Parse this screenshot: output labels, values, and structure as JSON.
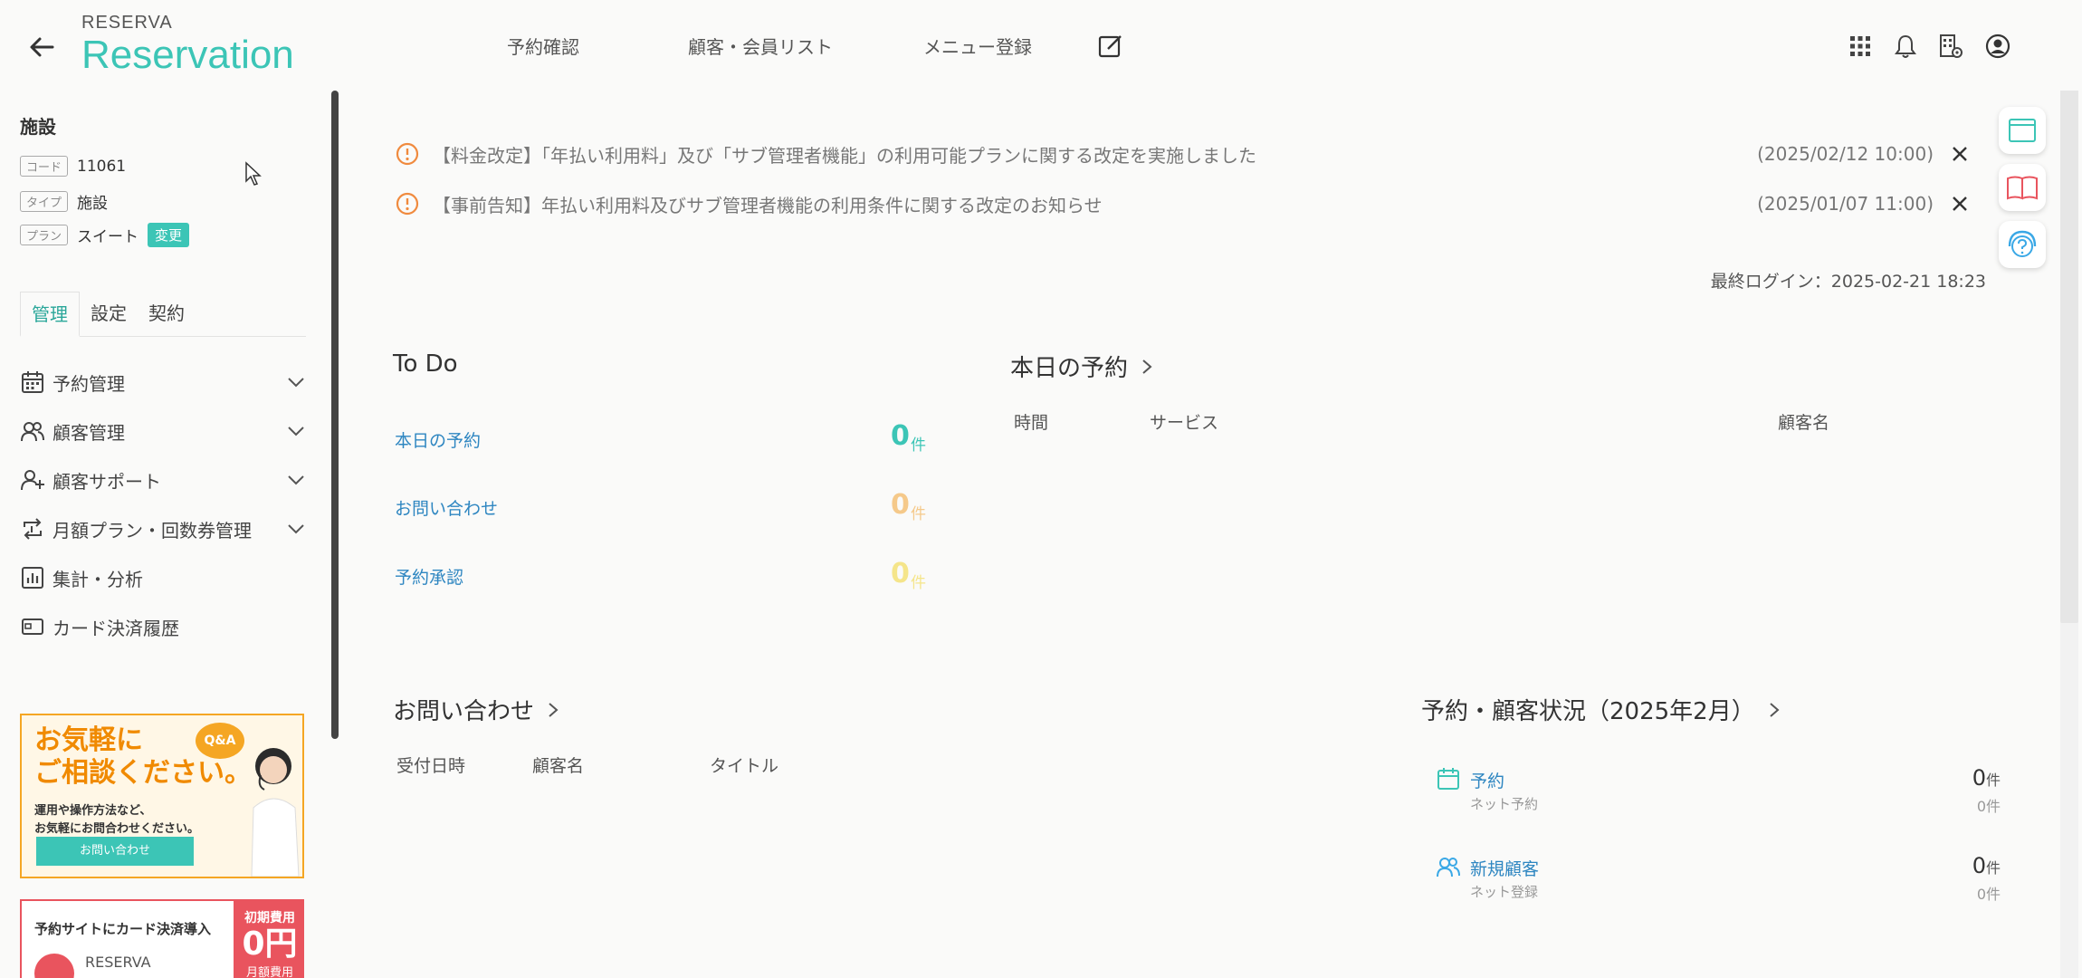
{
  "header": {
    "logo_small": "RESERVA",
    "logo_big": "Reservation",
    "nav": [
      "予約確認",
      "顧客・会員リスト",
      "メニュー登録"
    ]
  },
  "sidebar": {
    "title": "施設",
    "code_tag": "コード",
    "code_value": "11061",
    "type_tag": "タイプ",
    "type_value": "施設",
    "plan_tag": "プラン",
    "plan_value": "スイート",
    "change_label": "変更",
    "tabs": [
      "管理",
      "設定",
      "契約"
    ],
    "active_tab": "管理",
    "menu": [
      {
        "label": "予約管理",
        "icon": "calendar-icon",
        "expandable": true
      },
      {
        "label": "顧客管理",
        "icon": "users-icon",
        "expandable": true
      },
      {
        "label": "顧客サポート",
        "icon": "user-plus-icon",
        "expandable": true
      },
      {
        "label": "月額プラン・回数券管理",
        "icon": "repeat-icon",
        "expandable": true
      },
      {
        "label": "集計・分析",
        "icon": "chart-icon",
        "expandable": false
      },
      {
        "label": "カード決済履歴",
        "icon": "card-icon",
        "expandable": false
      }
    ],
    "banner1": {
      "title_line1": "お気軽に",
      "title_line2": "ご相談ください。",
      "badge": "Q&A",
      "sub_line1": "運用や操作方法など、",
      "sub_line2": "お気軽にお問合わせください。",
      "button": "お問い合わせ"
    },
    "banner2": {
      "text": "予約サイトにカード決済導入",
      "side_line1": "初期費用",
      "side_line2": "0円",
      "side_line3": "月額費用",
      "logo": "RESERVA"
    }
  },
  "notices": [
    {
      "text": "【料金改定】「年払い利用料」及び「サブ管理者機能」の利用可能プランに関する改定を実施しました",
      "date": "(2025/02/12 10:00)"
    },
    {
      "text": "【事前告知】年払い利用料及びサブ管理者機能の利用条件に関する改定のお知らせ",
      "date": "(2025/01/07 11:00)"
    }
  ],
  "last_login": "最終ログイン：2025-02-21 18:23",
  "todo": {
    "title": "To Do",
    "items": [
      {
        "label": "本日の予約",
        "count": "0",
        "unit": "件",
        "color": "#3cc5b6"
      },
      {
        "label": "お問い合わせ",
        "count": "0",
        "unit": "件",
        "color": "#f5c98a"
      },
      {
        "label": "予約承認",
        "count": "0",
        "unit": "件",
        "color": "#f5e58a"
      }
    ]
  },
  "today": {
    "title": "本日の予約",
    "columns": [
      "時間",
      "サービス",
      "顧客名"
    ]
  },
  "inquiries": {
    "title": "お問い合わせ",
    "columns": [
      "受付日時",
      "顧客名",
      "タイトル"
    ]
  },
  "status": {
    "title": "予約・顧客状況（2025年2月）",
    "items": [
      {
        "label": "予約",
        "sub": "ネット予約",
        "count": "0",
        "unit": "件",
        "sub_count": "0件"
      },
      {
        "label": "新規顧客",
        "sub": "ネット登録",
        "count": "0",
        "unit": "件",
        "sub_count": "0件"
      }
    ]
  },
  "colors": {
    "accent": "#3cc5b6",
    "link": "#2e86c1",
    "notice": "#f08a3e"
  }
}
